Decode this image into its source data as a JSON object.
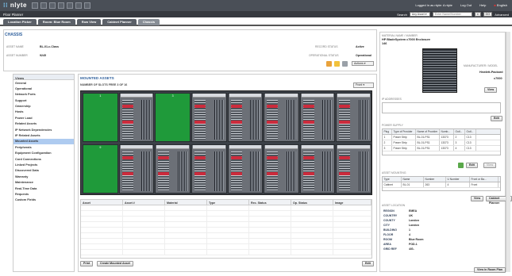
{
  "app": {
    "logo": "nlyte",
    "subtitle": "Floor Planner",
    "user_text": "Logged in as nlyte: A nlyte",
    "logout": "Log Out",
    "help": "Help",
    "language": "English"
  },
  "search": {
    "label": "Search",
    "type_value": "Any Asset",
    "input_placeholder": "Enter Name/Number",
    "go": "GO",
    "advanced": "Advanced"
  },
  "tabs": [
    {
      "label": "Location Picker"
    },
    {
      "label": "Room: Blue Room"
    },
    {
      "label": "Row View"
    },
    {
      "label": "Cabinet Planner"
    },
    {
      "label": "Chassis"
    }
  ],
  "chassis": {
    "title": "CHASSIS",
    "asset_name_label": "ASSET NAME",
    "asset_name": "BL-01-c-Class",
    "asset_number_label": "ASSET NUMBER",
    "asset_number": "9245",
    "record_status_label": "RECORD STATUS",
    "record_status": "Active",
    "operational_status_label": "OPERATIONAL STATUS",
    "operational_status": "Operational",
    "actions": "Actions"
  },
  "views": {
    "header": "Views",
    "items": [
      "General",
      "Operational",
      "Network Ports",
      "Support",
      "Ownership",
      "Hosts",
      "Power Load",
      "Related Assets",
      "IP Network Dependencies",
      "IP Related Assets",
      "Mounted Assets",
      "Peripherals",
      "Equipment Configuration",
      "Cord Connections",
      "Linked Projects",
      "Discovered Data",
      "Warranty",
      "Maintenance",
      "Real-Time Data",
      "Requests",
      "Custom Fields"
    ],
    "selected": "Mounted Assets"
  },
  "mounted": {
    "title": "MOUNTED ASSETS",
    "slots_free": "NUMBER OF SLOTS FREE  3 OF 16",
    "view_select": "Front",
    "top_slots": [
      "1",
      "2",
      "3",
      "4",
      "5",
      "6",
      "7",
      "8"
    ],
    "bottom_slots": [
      "9",
      "10",
      "11",
      "12",
      "13",
      "14",
      "15",
      "16"
    ],
    "table_headers": [
      "Asset",
      "Asset #",
      "Material",
      "Type",
      "Rec. Status",
      "Op. Status",
      "Image"
    ],
    "print": "Print",
    "create": "Create Mounted Asset",
    "edit": "Edit"
  },
  "right": {
    "material_label": "MATERIAL NAME / NUMBER",
    "material_name": "HP BladeSystem c7000 Enclosure",
    "material_number": "146",
    "manufacturer_label": "MANUFACTURER / MODEL",
    "manufacturer": "Hewlett-Packard",
    "model": "c7000",
    "view": "View",
    "ip_label": "IP ADDRESSES",
    "edit": "Edit",
    "power_label": "POWER SUPPLY",
    "power_headers": [
      "Plug",
      "Type of Provider",
      "Name of Provider",
      "Numb...",
      "Outl...",
      "Outl..."
    ],
    "power_rows": [
      [
        "1",
        "Power Strip",
        "BL-01-PS1",
        "13373",
        "2",
        "C13"
      ],
      [
        "2",
        "Power Strip",
        "BL-01-PS1",
        "13373",
        "3",
        "C13"
      ],
      [
        "3",
        "Power Strip",
        "BL-01-PS1",
        "13373",
        "4",
        "C13"
      ]
    ],
    "mounting_label": "ASSET MOUNTING",
    "mounting_headers": [
      "Type",
      "Name",
      "Number",
      "U Number",
      "Front or Ba..."
    ],
    "mounting_row": [
      "Cabinet",
      "BL-01",
      "263",
      "4",
      "Front"
    ],
    "cabinet_planner": "Cabinet Planner",
    "location_label": "ASSET LOCATION",
    "location": [
      {
        "k": "REGION",
        "v": "EMEA"
      },
      {
        "k": "COUNTRY",
        "v": "UK"
      },
      {
        "k": "COUNTY",
        "v": "London"
      },
      {
        "k": "CITY",
        "v": "London"
      },
      {
        "k": "BUILDING",
        "v": "1"
      },
      {
        "k": "FLOOR",
        "v": "4"
      },
      {
        "k": "ROOM",
        "v": "Blue Room"
      },
      {
        "k": "AREA",
        "v": "POD-1"
      },
      {
        "k": "GRID REF",
        "v": "4/G-"
      }
    ],
    "view_room": "View in Room Plan"
  },
  "colors": {
    "accent": "#2e5f9c",
    "slot_green": "#1f9a3a",
    "topbar": "#4a4f57"
  }
}
